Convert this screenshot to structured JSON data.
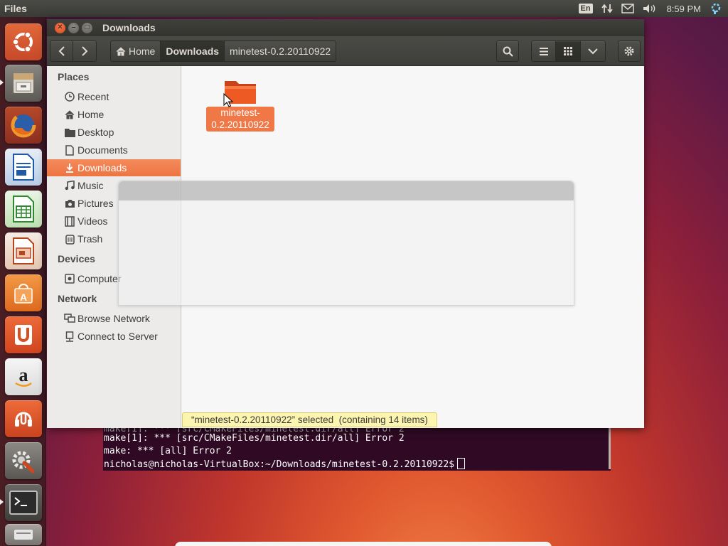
{
  "top_panel": {
    "app_name": "Files",
    "keyboard_layout": "En",
    "clock": "8:59 PM",
    "icons": [
      "network-arrows-icon",
      "mail-icon",
      "volume-icon",
      "settings-indicator-icon"
    ]
  },
  "launcher": {
    "items": [
      {
        "name": "ubuntu-dash",
        "icon": "ubuntu-logo-icon"
      },
      {
        "name": "files",
        "icon": "file-cabinet-icon",
        "running": true
      },
      {
        "name": "firefox",
        "icon": "firefox-icon"
      },
      {
        "name": "libreoffice-writer",
        "icon": "writer-icon"
      },
      {
        "name": "libreoffice-calc",
        "icon": "calc-icon"
      },
      {
        "name": "libreoffice-impress",
        "icon": "impress-icon"
      },
      {
        "name": "software-center",
        "icon": "shopping-bag-icon"
      },
      {
        "name": "ubuntu-one",
        "icon": "ubuntu-one-icon"
      },
      {
        "name": "amazon",
        "icon": "amazon-icon"
      },
      {
        "name": "ubuntu-one-music",
        "icon": "music-store-icon"
      },
      {
        "name": "system-settings",
        "icon": "wrench-gear-icon"
      },
      {
        "name": "terminal",
        "icon": "terminal-icon",
        "running": true
      },
      {
        "name": "removable-drive",
        "icon": "drive-icon"
      }
    ]
  },
  "window": {
    "title": "Downloads",
    "path": [
      {
        "label": "Home",
        "icon": "home-icon"
      },
      {
        "label": "Downloads",
        "active": true
      },
      {
        "label": "minetest-0.2.20110922"
      }
    ]
  },
  "sidebar": {
    "sections": [
      {
        "title": "Places",
        "items": [
          {
            "label": "Recent",
            "icon": "clock-icon"
          },
          {
            "label": "Home",
            "icon": "home-icon"
          },
          {
            "label": "Desktop",
            "icon": "folder-icon"
          },
          {
            "label": "Documents",
            "icon": "document-icon"
          },
          {
            "label": "Downloads",
            "icon": "download-icon",
            "selected": true
          },
          {
            "label": "Music",
            "icon": "music-note-icon"
          },
          {
            "label": "Pictures",
            "icon": "camera-icon"
          },
          {
            "label": "Videos",
            "icon": "film-icon"
          },
          {
            "label": "Trash",
            "icon": "trash-icon"
          }
        ]
      },
      {
        "title": "Devices",
        "items": [
          {
            "label": "Computer",
            "icon": "computer-icon"
          }
        ]
      },
      {
        "title": "Network",
        "items": [
          {
            "label": "Browse Network",
            "icon": "network-icon"
          },
          {
            "label": "Connect to Server",
            "icon": "server-icon"
          }
        ]
      }
    ]
  },
  "content": {
    "folder": {
      "label": "minetest-0.2.20110922",
      "label_line1": "minetest-",
      "label_line2": "0.2.20110922"
    },
    "status": "“minetest-0.2.20110922” selected  (containing 14 items)"
  },
  "terminal": {
    "lines": [
      "make[1]: *** [src/CMakeFiles/minetest.dir/all] Error 2",
      "make: *** [all] Error 2"
    ],
    "prompt": "nicholas@nicholas-VirtualBox:~/Downloads/minetest-0.2.20110922$"
  },
  "colors": {
    "accent": "#f07746",
    "selection": "#ee7443",
    "panel": "#3c3b37",
    "terminal_bg": "#300a24",
    "status_bg": "#fbf5b0"
  }
}
